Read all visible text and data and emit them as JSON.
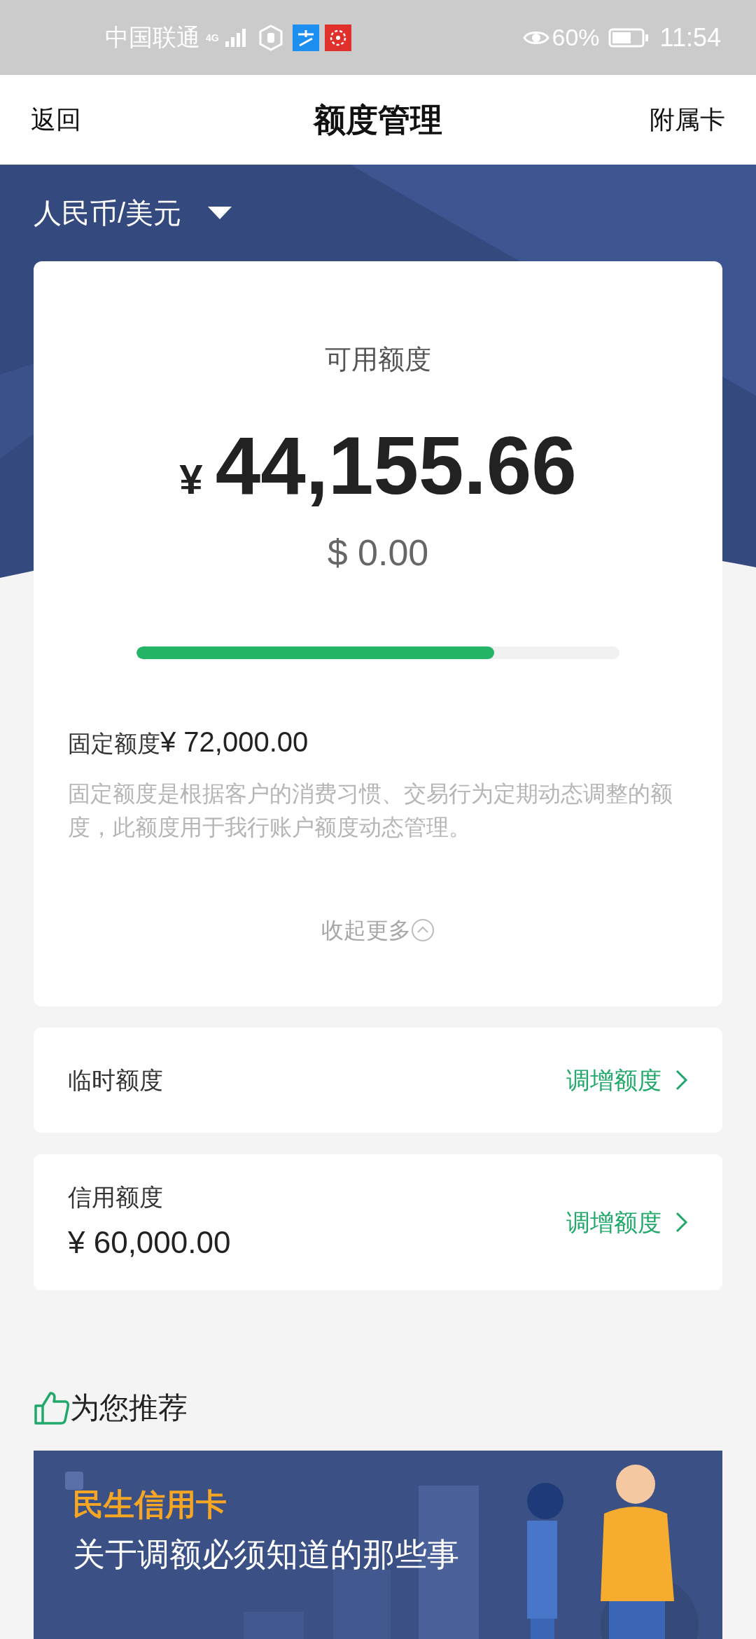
{
  "status_bar": {
    "carrier": "中国联通",
    "network": "4G",
    "battery_percent": "60%",
    "time": "11:54"
  },
  "nav": {
    "back": "返回",
    "title": "额度管理",
    "right": "附属卡"
  },
  "currency_selector": {
    "label": "人民币/美元"
  },
  "summary": {
    "title": "可用额度",
    "currency_symbol": "¥",
    "amount": "44,155.66",
    "secondary_amount": "$ 0.00",
    "level": 0.74,
    "fixed_label": "固定额度",
    "fixed_amount": "¥ 72,000.00",
    "description": "固定额度是根据客户的消费习惯、交易行为定期动态调整的额度，此额度用于我行账户额度动态管理。",
    "collapse": "收起更多",
    "expanded": true
  },
  "limit_rows": [
    {
      "label": "临时额度",
      "action": "调增额度"
    },
    {
      "label": "信用额度",
      "value": "¥ 60,000.00",
      "action": "调增额度"
    }
  ],
  "recommend": {
    "title": "为您推荐",
    "banner": {
      "brand": "民生信用卡",
      "headline": "关于调额必须知道的那些事"
    }
  }
}
